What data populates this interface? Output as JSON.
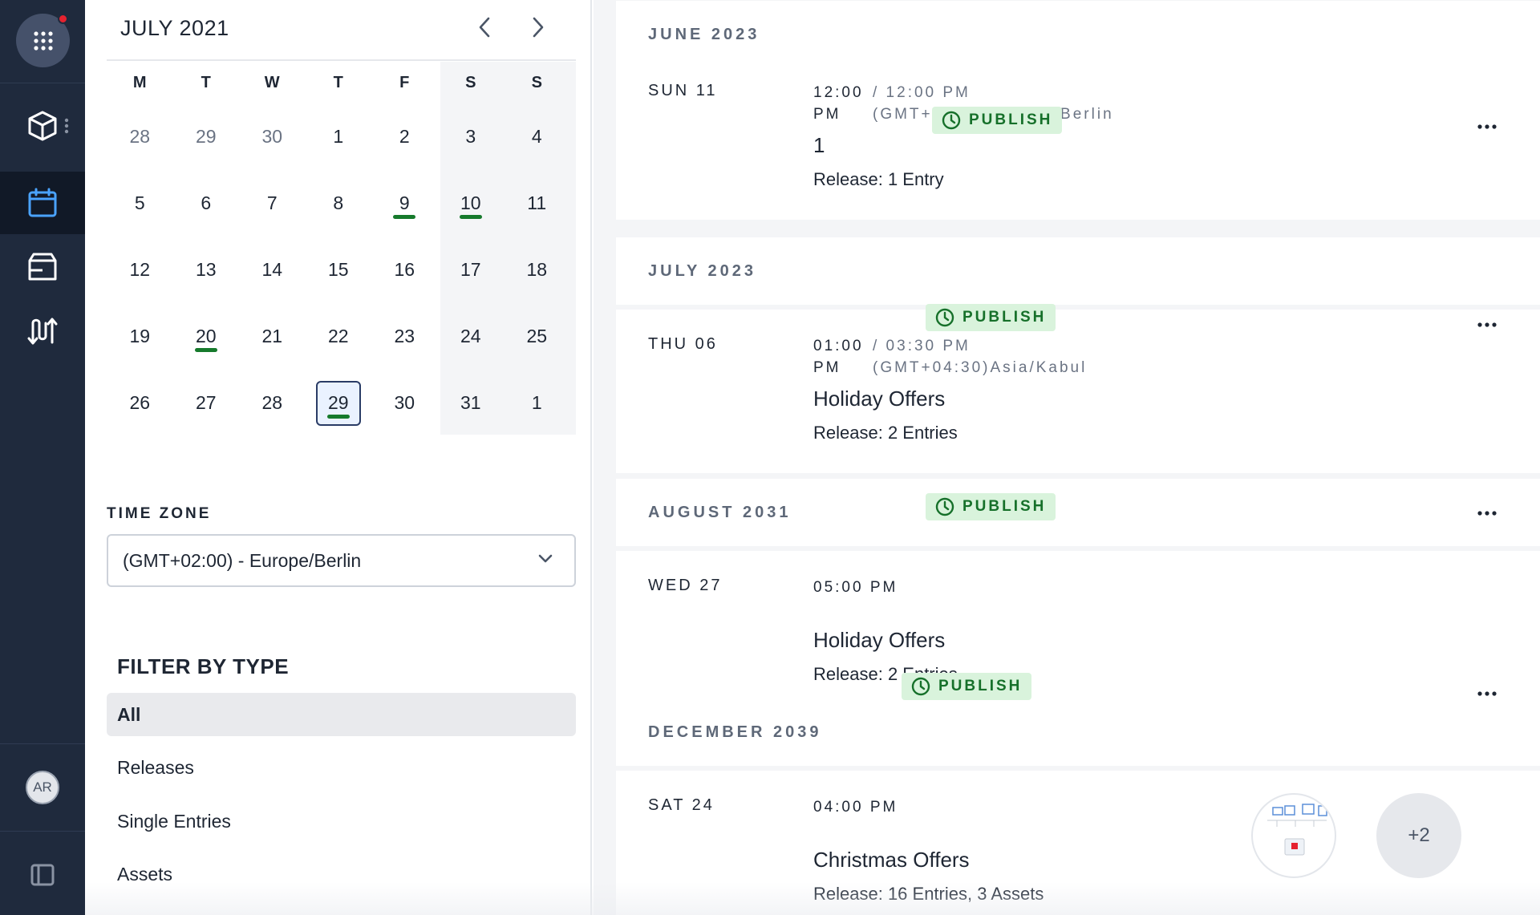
{
  "sidebar": {
    "app_menu_icon": "grid-dots-icon",
    "items": [
      {
        "name": "content-model",
        "icon": "cube-icon"
      },
      {
        "name": "schedule",
        "icon": "calendar-icon",
        "active": true
      },
      {
        "name": "releases",
        "icon": "package-icon"
      },
      {
        "name": "workflows",
        "icon": "arrows-icon"
      }
    ],
    "avatar_initials": "AR",
    "collapse_icon": "sidebar-toggle-icon"
  },
  "calendar": {
    "title": "JULY 2021",
    "weekdays": [
      "M",
      "T",
      "W",
      "T",
      "F",
      "S",
      "S"
    ],
    "weeks": [
      [
        {
          "d": "28",
          "muted": true
        },
        {
          "d": "29",
          "muted": true
        },
        {
          "d": "30",
          "muted": true
        },
        {
          "d": "1"
        },
        {
          "d": "2"
        },
        {
          "d": "3"
        },
        {
          "d": "4"
        }
      ],
      [
        {
          "d": "5"
        },
        {
          "d": "6"
        },
        {
          "d": "7"
        },
        {
          "d": "8"
        },
        {
          "d": "9",
          "marked": true
        },
        {
          "d": "10",
          "marked": true
        },
        {
          "d": "11"
        }
      ],
      [
        {
          "d": "12"
        },
        {
          "d": "13"
        },
        {
          "d": "14"
        },
        {
          "d": "15"
        },
        {
          "d": "16"
        },
        {
          "d": "17"
        },
        {
          "d": "18"
        }
      ],
      [
        {
          "d": "19"
        },
        {
          "d": "20",
          "marked": true
        },
        {
          "d": "21"
        },
        {
          "d": "22"
        },
        {
          "d": "23"
        },
        {
          "d": "24"
        },
        {
          "d": "25"
        }
      ],
      [
        {
          "d": "26"
        },
        {
          "d": "27"
        },
        {
          "d": "28"
        },
        {
          "d": "29",
          "marked": true,
          "today": true
        },
        {
          "d": "30"
        },
        {
          "d": "31"
        },
        {
          "d": "1"
        }
      ]
    ]
  },
  "timezone": {
    "label": "TIME ZONE",
    "value": "(GMT+02:00) - Europe/Berlin"
  },
  "filter": {
    "title": "FILTER BY TYPE",
    "items": [
      {
        "label": "All",
        "active": true
      },
      {
        "label": "Releases"
      },
      {
        "label": "Single Entries"
      },
      {
        "label": "Assets"
      }
    ]
  },
  "schedule": {
    "months": [
      {
        "label": "JUNE 2023",
        "events": [
          {
            "date": "SUN 11",
            "time": "12:00 PM",
            "local": "/ 12:00 PM (GMT+02:00)Europe/Berlin",
            "title": "1",
            "subtitle": "Release: 1 Entry",
            "badge": "PUBLISH"
          }
        ]
      },
      {
        "label": "JULY 2023",
        "events": [
          {
            "date": "THU 06",
            "time": "01:00 PM",
            "local": "/ 03:30 PM (GMT+04:30)Asia/Kabul",
            "title": "Holiday Offers",
            "subtitle": "Release: 2 Entries",
            "badge": "PUBLISH"
          }
        ]
      },
      {
        "label": "AUGUST 2031",
        "events": [
          {
            "date": "WED 27",
            "time": "05:00 PM",
            "title": "Holiday Offers",
            "subtitle": "Release: 2 Entries",
            "badge": "PUBLISH"
          }
        ]
      },
      {
        "label": "DECEMBER 2039",
        "events": [
          {
            "date": "SAT 24",
            "time": "04:00 PM",
            "title": "Christmas Offers",
            "subtitle": "Release: 16 Entries, 3 Assets",
            "badge": "PUBLISH",
            "extra_count": "+2"
          }
        ]
      }
    ]
  },
  "colors": {
    "rail": "#1f2a3d",
    "badge_bg": "#d9f3dc",
    "badge_text": "#16702a",
    "marker": "#167a2c"
  }
}
